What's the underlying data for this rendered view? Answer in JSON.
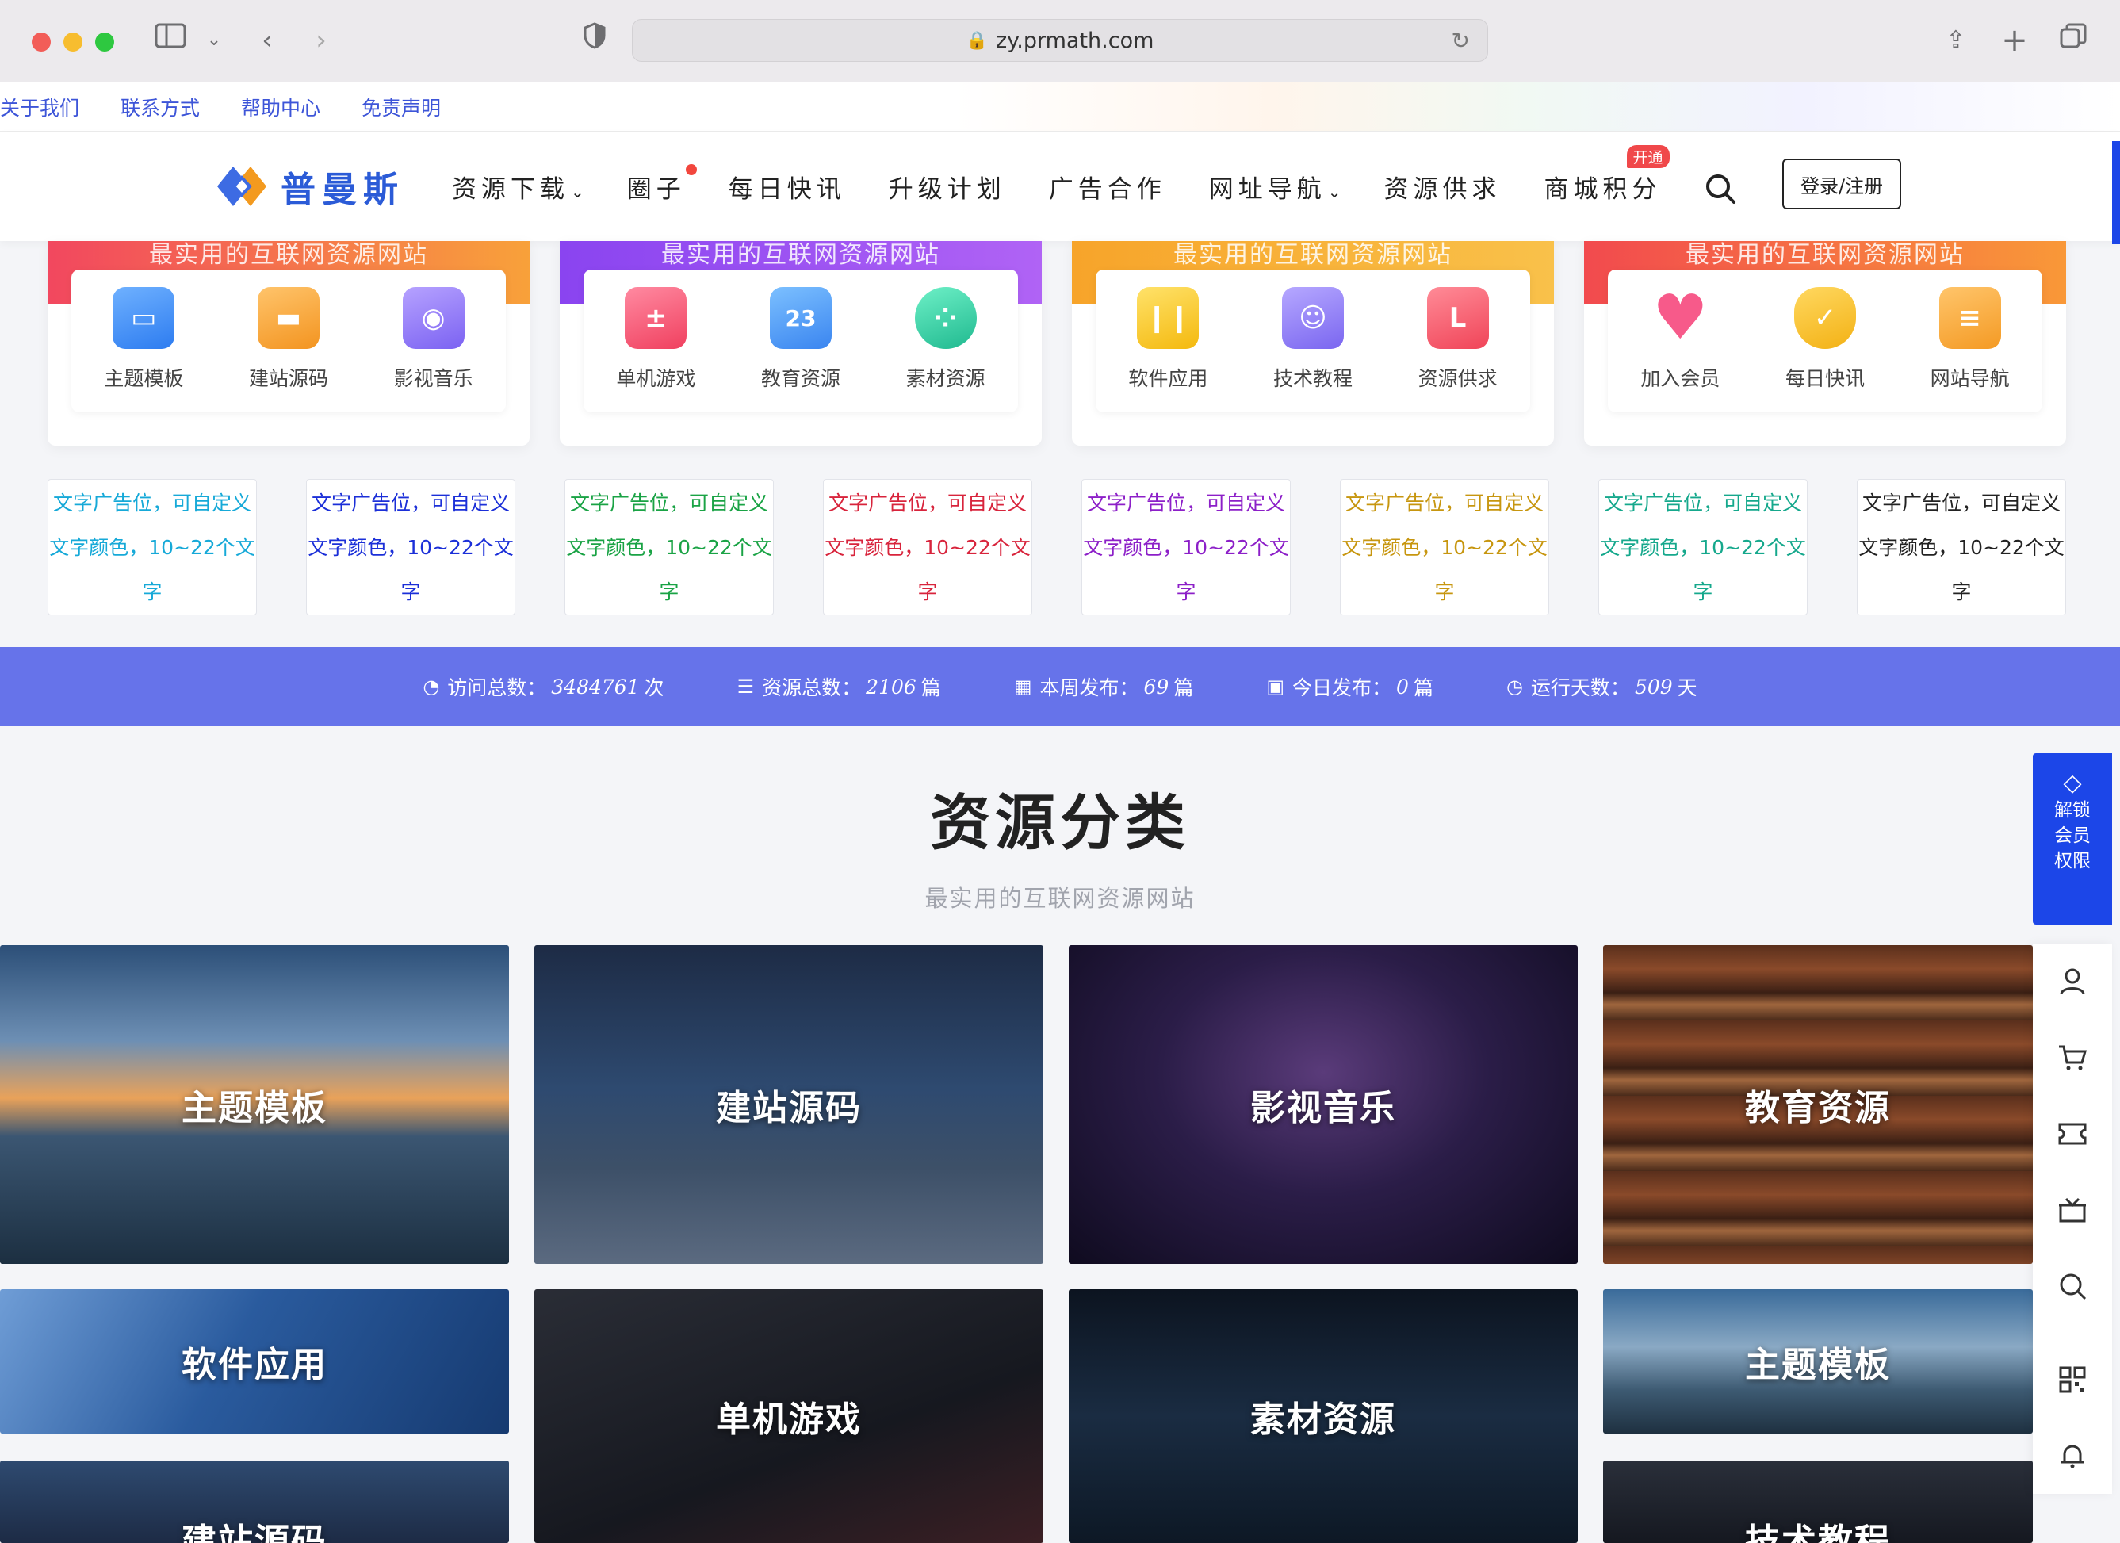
{
  "browser": {
    "url": "zy.prmath.com"
  },
  "toplinks": [
    "关于我们",
    "联系方式",
    "帮助中心",
    "免责声明"
  ],
  "header": {
    "logo_text": "普曼斯",
    "nav": [
      {
        "label": "资源下载",
        "has_menu": true
      },
      {
        "label": "圈子",
        "dot": true
      },
      {
        "label": "每日快讯"
      },
      {
        "label": "升级计划"
      },
      {
        "label": "广告合作"
      },
      {
        "label": "网址导航",
        "has_menu": true
      },
      {
        "label": "资源供求"
      },
      {
        "label": "商城积分",
        "badge": "开通"
      }
    ],
    "login": "登录/注册"
  },
  "banners": [
    {
      "title": "最实用的互联网资源网站",
      "items": [
        "主题模板",
        "建站源码",
        "影视音乐"
      ]
    },
    {
      "title": "最实用的互联网资源网站",
      "items": [
        "单机游戏",
        "教育资源",
        "素材资源"
      ]
    },
    {
      "title": "最实用的互联网资源网站",
      "items": [
        "软件应用",
        "技术教程",
        "资源供求"
      ]
    },
    {
      "title": "最实用的互联网资源网站",
      "items": [
        "加入会员",
        "每日快讯",
        "网站导航"
      ]
    }
  ],
  "calendar_number": "23",
  "ads": {
    "line1": "文字广告位，可自定义",
    "line2": "文字颜色，10~22个文",
    "line3": "字",
    "colors": [
      "#16a9d8",
      "#1b2fd8",
      "#1aa345",
      "#d8243c",
      "#8c1fc8",
      "#c7960f",
      "#15a88c",
      "#222222"
    ]
  },
  "stats": [
    {
      "label": "访问总数：",
      "value": "3484761",
      "unit": "次"
    },
    {
      "label": "资源总数：",
      "value": "2106",
      "unit": "篇"
    },
    {
      "label": "本周发布：",
      "value": "69",
      "unit": "篇"
    },
    {
      "label": "今日发布：",
      "value": "0",
      "unit": "篇"
    },
    {
      "label": "运行天数：",
      "value": "509",
      "unit": "天"
    }
  ],
  "section": {
    "title": "资源分类",
    "subtitle": "最实用的互联网资源网站"
  },
  "tiles": [
    "主题模板",
    "建站源码",
    "影视音乐",
    "教育资源",
    "软件应用",
    "单机游戏",
    "素材资源",
    "主题模板",
    "建站源码",
    "技术教程"
  ],
  "side": {
    "unlock": [
      "解锁",
      "会员",
      "权限"
    ]
  }
}
